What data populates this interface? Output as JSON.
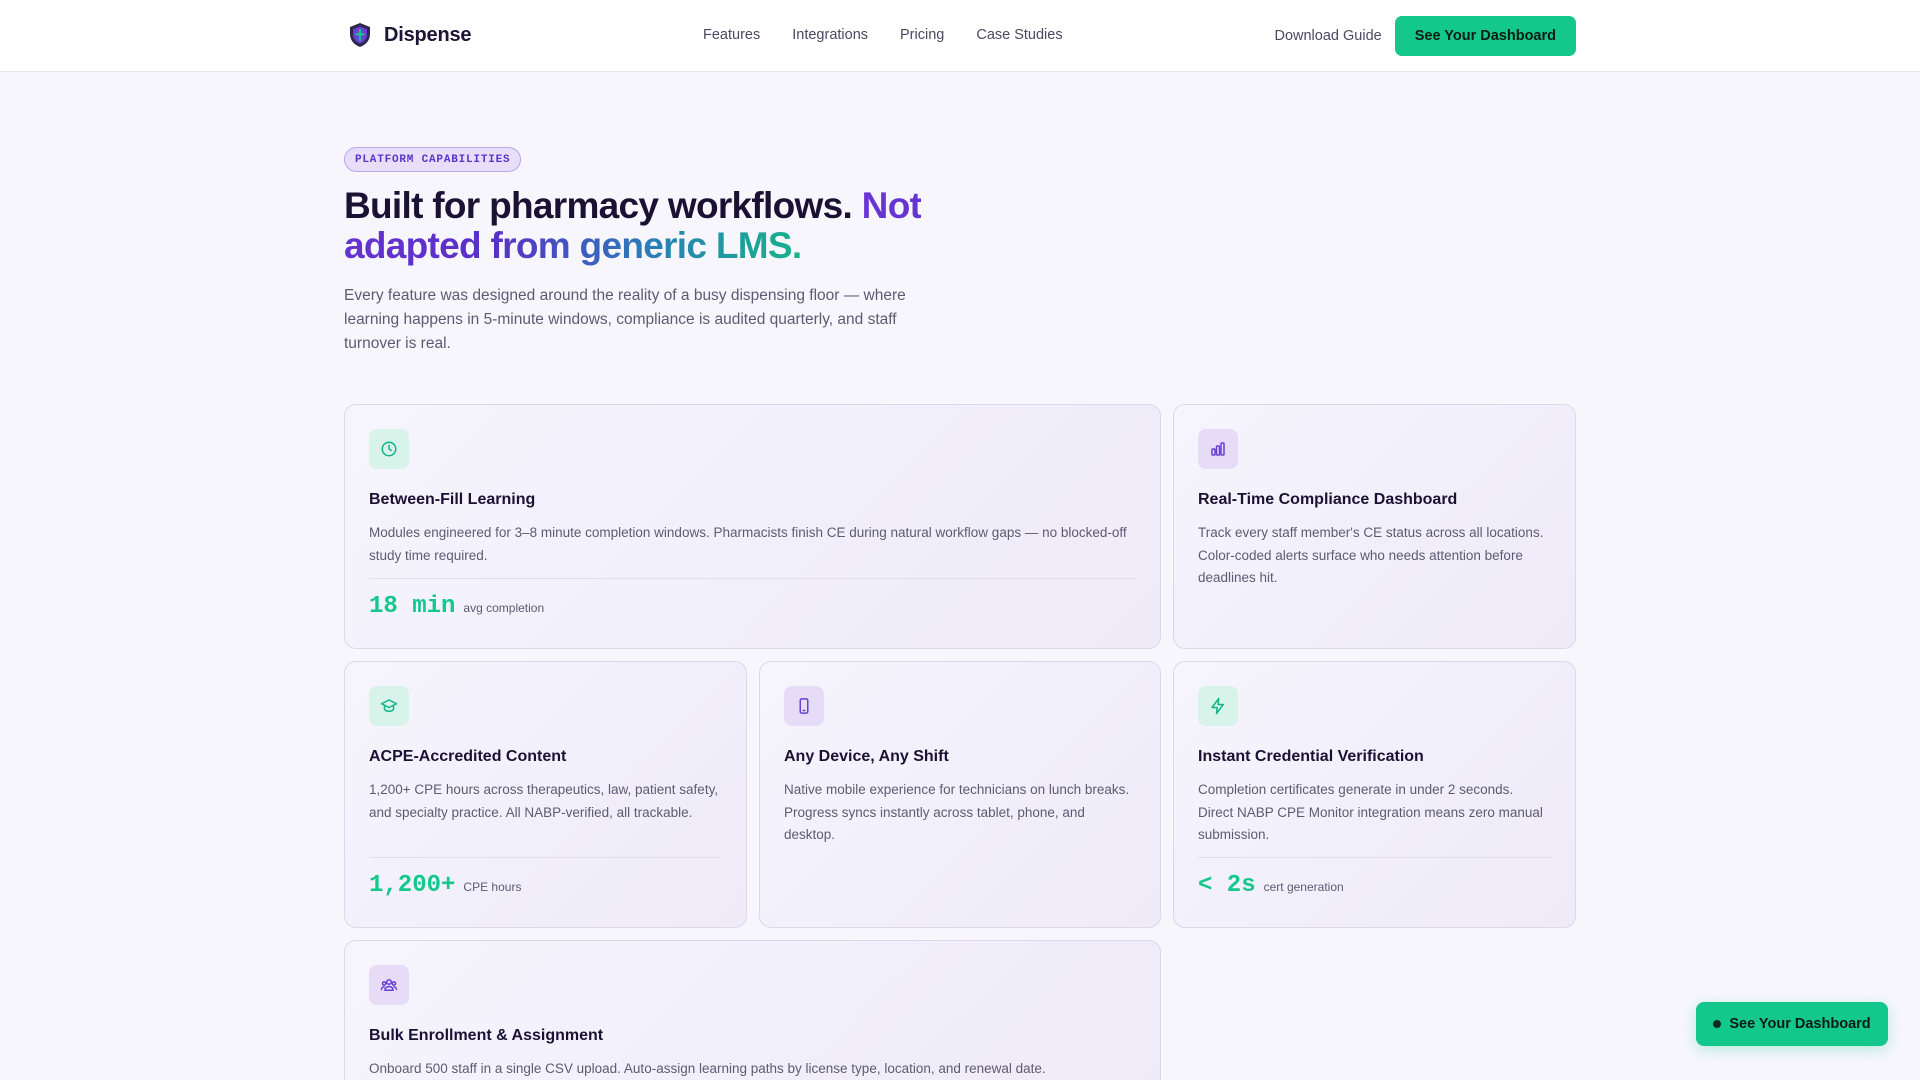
{
  "brand": {
    "name": "Dispense",
    "logo_icon": "shield-icon"
  },
  "nav": {
    "links": [
      "Features",
      "Integrations",
      "Pricing",
      "Case Studies"
    ],
    "guide_label": "Download Guide",
    "cta_label": "See Your Dashboard"
  },
  "hero": {
    "eyebrow": "PLATFORM CAPABILITIES",
    "title_plain": "Built for pharmacy workflows.",
    "title_accent": "Not adapted from generic LMS.",
    "subtitle": "Every feature was designed around the reality of a busy dispensing floor — where learning happens in 5-minute windows, compliance is audited quarterly, and staff turnover is real."
  },
  "cards": [
    {
      "icon": "clock-icon",
      "icon_color": "#14b386",
      "title": "Between-Fill Learning",
      "description": "Modules engineered for 3–8 minute completion windows. Pharmacists finish CE during natural workflow gaps — no blocked-off study time required.",
      "stat_value": "18 min",
      "stat_label": "avg completion"
    },
    {
      "icon": "bar-chart-icon",
      "icon_color": "#6a3fd2",
      "title": "Real-Time Compliance Dashboard",
      "description": "Track every staff member's CE status across all locations. Color-coded alerts surface who needs attention before deadlines hit."
    },
    {
      "icon": "graduation-cap-icon",
      "icon_color": "#14b386",
      "title": "ACPE-Accredited Content",
      "description": "1,200+ CPE hours across therapeutics, law, patient safety, and specialty practice. All NABP-verified, all trackable.",
      "stat_value": "1,200+",
      "stat_label": "CPE hours"
    },
    {
      "icon": "smartphone-icon",
      "icon_color": "#6a3fd2",
      "title": "Any Device, Any Shift",
      "description": "Native mobile experience for technicians on lunch breaks. Progress syncs instantly across tablet, phone, and desktop."
    },
    {
      "icon": "lightning-icon",
      "icon_color": "#14b386",
      "title": "Instant Credential Verification",
      "description": "Completion certificates generate in under 2 seconds. Direct NABP CPE Monitor integration means zero manual submission.",
      "stat_value": "< 2s",
      "stat_label": "cert generation"
    },
    {
      "icon": "users-icon",
      "icon_color": "#6a3fd2",
      "title": "Bulk Enrollment & Assignment",
      "description": "Onboard 500 staff in a single CSV upload. Auto-assign learning paths by license type, location, and renewal date."
    }
  ],
  "floating_cta": {
    "label": "See Your Dashboard"
  },
  "colors": {
    "accent_green": "#14c88c",
    "accent_purple": "#6a35d6",
    "text_dark": "#1a1233",
    "text_muted": "#5e5a72"
  }
}
